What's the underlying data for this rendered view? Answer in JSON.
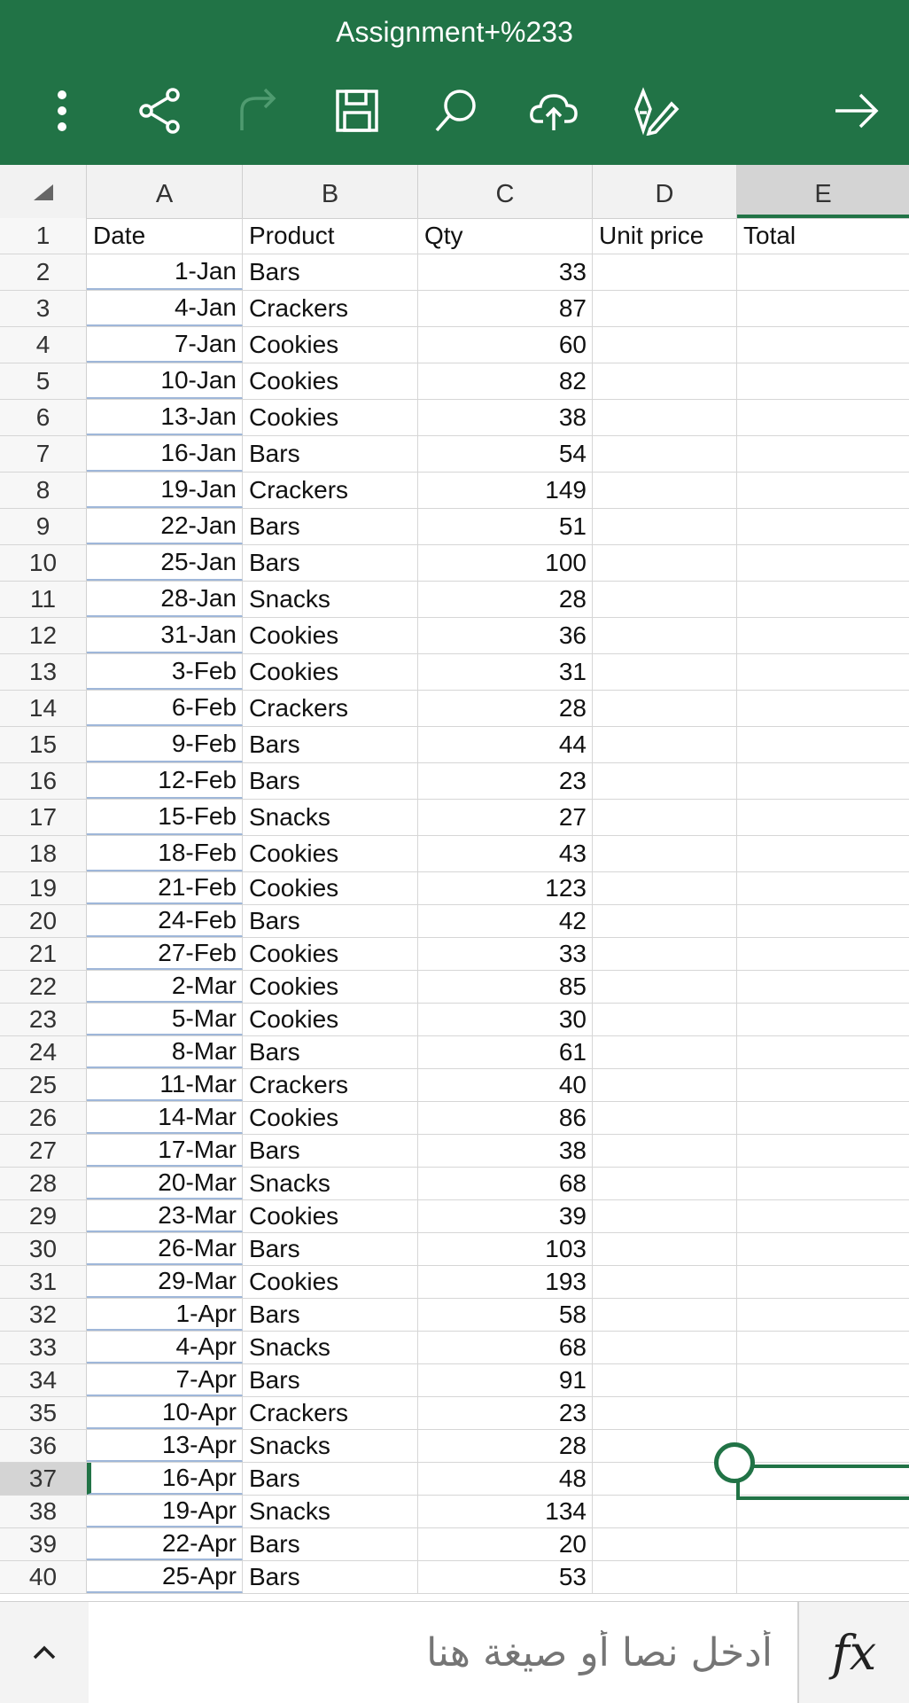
{
  "app": {
    "title": "Assignment+%233",
    "accent": "#217346"
  },
  "toolbar": {
    "buttons": [
      {
        "name": "more-icon"
      },
      {
        "name": "share-icon"
      },
      {
        "name": "redo-icon"
      },
      {
        "name": "save-icon"
      },
      {
        "name": "search-icon"
      },
      {
        "name": "cloud-upload-icon"
      },
      {
        "name": "draw-pen-icon"
      },
      {
        "name": "arrow-forward-icon"
      }
    ]
  },
  "sheet": {
    "columns": [
      "A",
      "B",
      "C",
      "D",
      "E"
    ],
    "selected_column": "E",
    "selected_row": "37",
    "rows": [
      {
        "n": "1",
        "a": "Date",
        "b": "Product",
        "c": "Qty",
        "d": "Unit price",
        "e": "Total"
      },
      {
        "n": "2",
        "a": "1-Jan",
        "b": "Bars",
        "c": "33",
        "d": "",
        "e": ""
      },
      {
        "n": "3",
        "a": "4-Jan",
        "b": "Crackers",
        "c": "87",
        "d": "",
        "e": ""
      },
      {
        "n": "4",
        "a": "7-Jan",
        "b": "Cookies",
        "c": "60",
        "d": "",
        "e": ""
      },
      {
        "n": "5",
        "a": "10-Jan",
        "b": "Cookies",
        "c": "82",
        "d": "",
        "e": ""
      },
      {
        "n": "6",
        "a": "13-Jan",
        "b": "Cookies",
        "c": "38",
        "d": "",
        "e": ""
      },
      {
        "n": "7",
        "a": "16-Jan",
        "b": "Bars",
        "c": "54",
        "d": "",
        "e": ""
      },
      {
        "n": "8",
        "a": "19-Jan",
        "b": "Crackers",
        "c": "149",
        "d": "",
        "e": ""
      },
      {
        "n": "9",
        "a": "22-Jan",
        "b": "Bars",
        "c": "51",
        "d": "",
        "e": ""
      },
      {
        "n": "10",
        "a": "25-Jan",
        "b": "Bars",
        "c": "100",
        "d": "",
        "e": ""
      },
      {
        "n": "11",
        "a": "28-Jan",
        "b": "Snacks",
        "c": "28",
        "d": "",
        "e": ""
      },
      {
        "n": "12",
        "a": "31-Jan",
        "b": "Cookies",
        "c": "36",
        "d": "",
        "e": ""
      },
      {
        "n": "13",
        "a": "3-Feb",
        "b": "Cookies",
        "c": "31",
        "d": "",
        "e": ""
      },
      {
        "n": "14",
        "a": "6-Feb",
        "b": "Crackers",
        "c": "28",
        "d": "",
        "e": ""
      },
      {
        "n": "15",
        "a": "9-Feb",
        "b": "Bars",
        "c": "44",
        "d": "",
        "e": ""
      },
      {
        "n": "16",
        "a": "12-Feb",
        "b": "Bars",
        "c": "23",
        "d": "",
        "e": ""
      },
      {
        "n": "17",
        "a": "15-Feb",
        "b": "Snacks",
        "c": "27",
        "d": "",
        "e": ""
      },
      {
        "n": "18",
        "a": "18-Feb",
        "b": "Cookies",
        "c": "43",
        "d": "",
        "e": ""
      },
      {
        "n": "19",
        "a": "21-Feb",
        "b": "Cookies",
        "c": "123",
        "d": "",
        "e": ""
      },
      {
        "n": "20",
        "a": "24-Feb",
        "b": "Bars",
        "c": "42",
        "d": "",
        "e": ""
      },
      {
        "n": "21",
        "a": "27-Feb",
        "b": "Cookies",
        "c": "33",
        "d": "",
        "e": ""
      },
      {
        "n": "22",
        "a": "2-Mar",
        "b": "Cookies",
        "c": "85",
        "d": "",
        "e": ""
      },
      {
        "n": "23",
        "a": "5-Mar",
        "b": "Cookies",
        "c": "30",
        "d": "",
        "e": ""
      },
      {
        "n": "24",
        "a": "8-Mar",
        "b": "Bars",
        "c": "61",
        "d": "",
        "e": ""
      },
      {
        "n": "25",
        "a": "11-Mar",
        "b": "Crackers",
        "c": "40",
        "d": "",
        "e": ""
      },
      {
        "n": "26",
        "a": "14-Mar",
        "b": "Cookies",
        "c": "86",
        "d": "",
        "e": ""
      },
      {
        "n": "27",
        "a": "17-Mar",
        "b": "Bars",
        "c": "38",
        "d": "",
        "e": ""
      },
      {
        "n": "28",
        "a": "20-Mar",
        "b": "Snacks",
        "c": "68",
        "d": "",
        "e": ""
      },
      {
        "n": "29",
        "a": "23-Mar",
        "b": "Cookies",
        "c": "39",
        "d": "",
        "e": ""
      },
      {
        "n": "30",
        "a": "26-Mar",
        "b": "Bars",
        "c": "103",
        "d": "",
        "e": ""
      },
      {
        "n": "31",
        "a": "29-Mar",
        "b": "Cookies",
        "c": "193",
        "d": "",
        "e": ""
      },
      {
        "n": "32",
        "a": "1-Apr",
        "b": "Bars",
        "c": "58",
        "d": "",
        "e": ""
      },
      {
        "n": "33",
        "a": "4-Apr",
        "b": "Snacks",
        "c": "68",
        "d": "",
        "e": ""
      },
      {
        "n": "34",
        "a": "7-Apr",
        "b": "Bars",
        "c": "91",
        "d": "",
        "e": ""
      },
      {
        "n": "35",
        "a": "10-Apr",
        "b": "Crackers",
        "c": "23",
        "d": "",
        "e": ""
      },
      {
        "n": "36",
        "a": "13-Apr",
        "b": "Snacks",
        "c": "28",
        "d": "",
        "e": ""
      },
      {
        "n": "37",
        "a": "16-Apr",
        "b": "Bars",
        "c": "48",
        "d": "",
        "e": ""
      },
      {
        "n": "38",
        "a": "19-Apr",
        "b": "Snacks",
        "c": "134",
        "d": "",
        "e": ""
      },
      {
        "n": "39",
        "a": "22-Apr",
        "b": "Bars",
        "c": "20",
        "d": "",
        "e": ""
      },
      {
        "n": "40",
        "a": "25-Apr",
        "b": "Bars",
        "c": "53",
        "d": "",
        "e": ""
      }
    ]
  },
  "formula_bar": {
    "placeholder": "أدخل نصا أو صيغة هنا",
    "fx_label": "fx",
    "expand_icon": "chevron-up-icon"
  }
}
